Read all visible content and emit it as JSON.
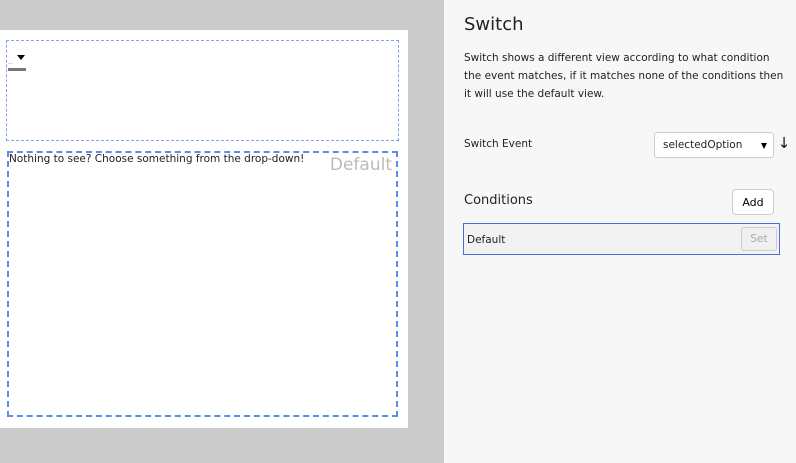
{
  "canvas": {
    "dropdown_value": "..",
    "default_text": "Nothing to see? Choose something from the drop-down!",
    "default_label": "Default"
  },
  "panel": {
    "title": "Switch",
    "description": "Switch shows a different view according to what condition the event matches, if it matches none of the conditions then it will use the default view.",
    "switch_event_label": "Switch Event",
    "switch_event_value": "selectedOption",
    "conditions_label": "Conditions",
    "add_label": "Add",
    "conditions": [
      {
        "name": "Default",
        "set_label": "Set"
      }
    ]
  }
}
